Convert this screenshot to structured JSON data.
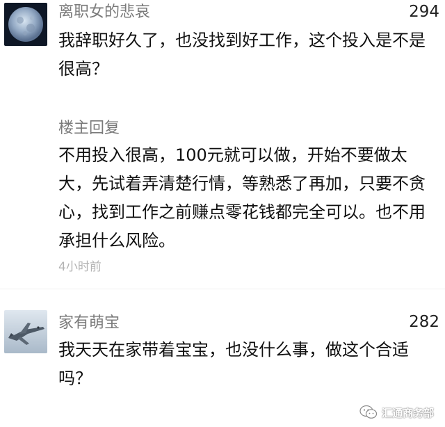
{
  "comments": [
    {
      "username": "离职女的悲哀",
      "likes": "294",
      "text": "我辞职好久了，也没找到好工作，这个投入是不是很高？",
      "reply": {
        "label": "楼主回复",
        "text": "不用投入很高，100元就可以做，开始不要做太大，先试着弄清楚行情，等熟悉了再加，只要不贪心，找到工作之前赚点零花钱都完全可以。也不用承担什么风险。",
        "time": "4小时前"
      },
      "avatar_icon": "moon-avatar-icon"
    },
    {
      "username": "家有萌宝",
      "likes": "282",
      "text": "我天天在家带着宝宝，也没什么事，做这个合适吗？",
      "avatar_icon": "jet-avatar-icon"
    }
  ],
  "watermark": {
    "text": "汇通商务部",
    "icon": "wechat-icon"
  }
}
